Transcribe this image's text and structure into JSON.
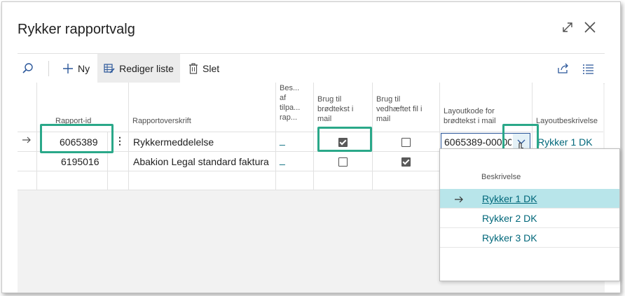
{
  "dialog": {
    "title": "Rykker rapportvalg"
  },
  "toolbar": {
    "new_label": "Ny",
    "edit_list_label": "Rediger liste",
    "delete_label": "Slet"
  },
  "columns": {
    "report_id": "Rapport-id",
    "report_caption": "Rapportoverskrift",
    "beskrivelse_l1": "Bes...",
    "beskrivelse_l2": "af",
    "beskrivelse_l3": "tilpa...",
    "beskrivelse_l4": "rap...",
    "use_body_l1": "Brug til",
    "use_body_l2": "brødtekst i",
    "use_body_l3": "mail",
    "use_attach_l1": "Brug til",
    "use_attach_l2": "vedhæftet fil i",
    "use_attach_l3": "mail",
    "layout_code_l1": "Layoutkode for",
    "layout_code_l2": "brødtekst i mail",
    "layout_desc": "Layoutbeskrivelse"
  },
  "rows": [
    {
      "report_id": "6065389",
      "report_caption": "Rykkermeddelelse",
      "custom_desc": "_",
      "use_body": true,
      "use_attach": false,
      "layout_code": "6065389-00000",
      "layout_desc": "Rykker 1 DK"
    },
    {
      "report_id": "6195016",
      "report_caption": "Abakion Legal standard faktura",
      "custom_desc": "_",
      "use_body": false,
      "use_attach": true
    }
  ],
  "dropdown": {
    "header": "Beskrivelse",
    "options": [
      "Rykker 1 DK",
      "Rykker 2 DK",
      "Rykker 3 DK"
    ],
    "selected_index": 0
  },
  "colors": {
    "highlight": "#2aa889",
    "selected_row": "#b8e5ea",
    "link": "#00677a"
  }
}
